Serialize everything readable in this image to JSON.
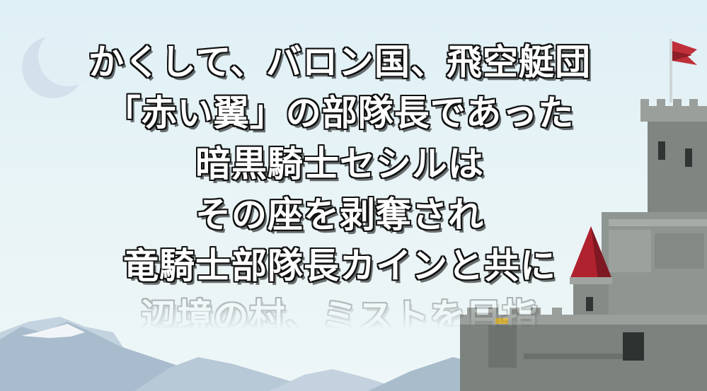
{
  "story_text": {
    "lines": [
      "かくして、バロン国、飛空艇団",
      "「赤い翼」の部隊長であった",
      "暗黒騎士セシルは",
      "その座を剥奪され",
      "竜騎士部隊長カインと共に",
      "辺境の村、ミストを目指"
    ]
  },
  "colors": {
    "sky": "#dff0f6",
    "text_fill": "#ffffff",
    "text_outline": "#111111",
    "castle_stone": "#8f9590",
    "roof_red": "#b0222e",
    "flag_red": "#c0303a",
    "mountain": "#a9bccd"
  },
  "scene": {
    "elements": [
      "moon",
      "mountains",
      "castle",
      "flag"
    ]
  }
}
